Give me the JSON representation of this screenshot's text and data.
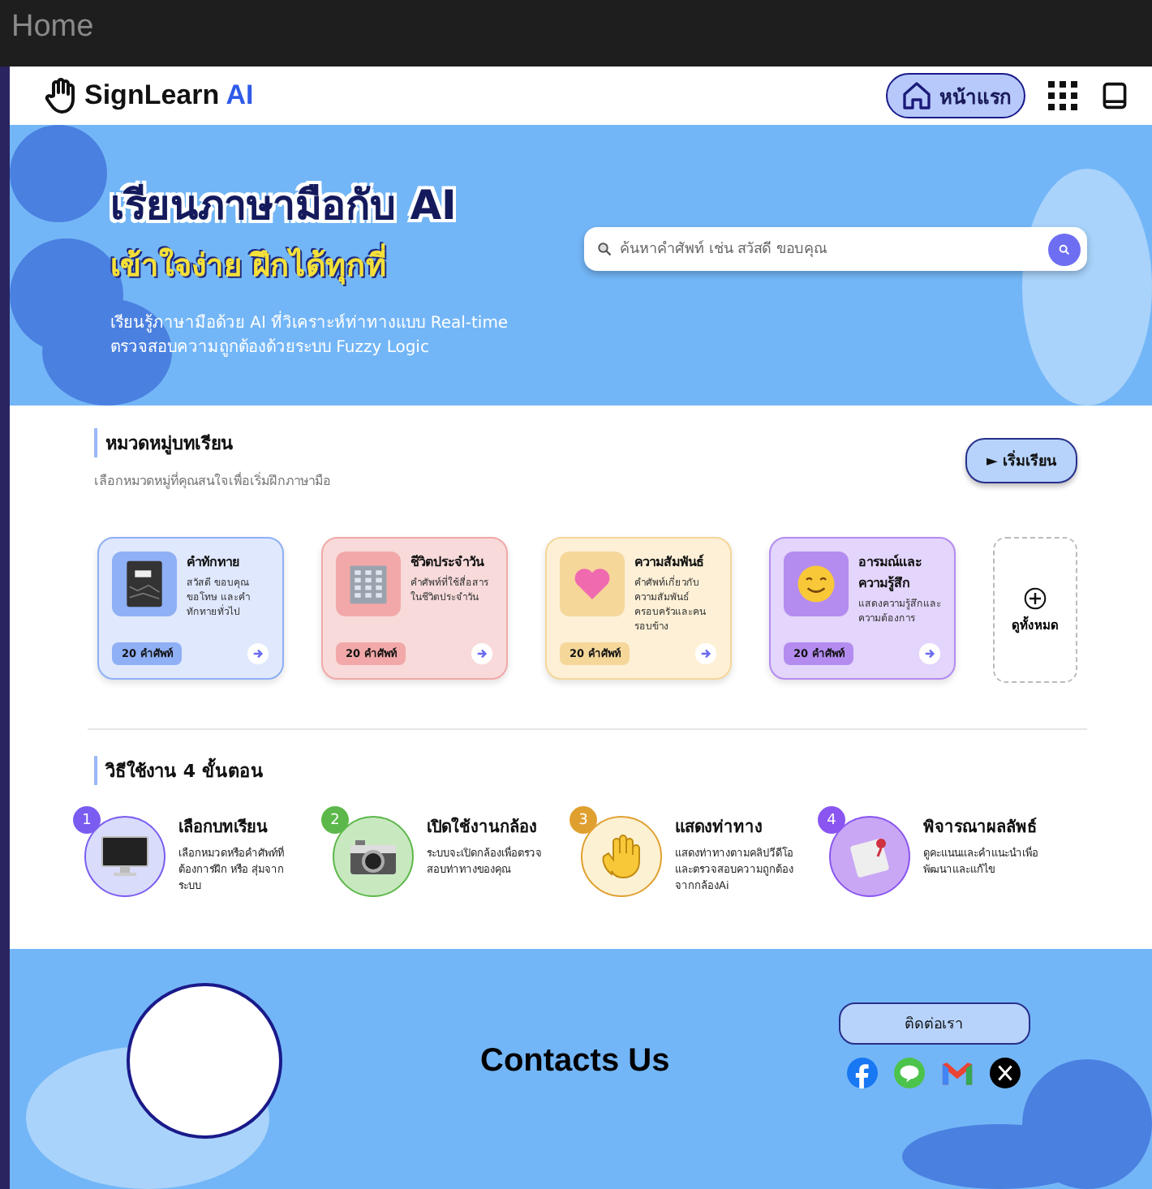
{
  "window": {
    "title": "Home"
  },
  "nav": {
    "logo": "SignLearn",
    "logo_accent": "AI",
    "home_button": "หน้าแรก"
  },
  "hero": {
    "title": "เรียนภาษามือกับ AI",
    "subtitle": "เข้าใจง่าย ฝึกได้ทุกที่",
    "description": [
      "เรียนรู้ภาษามือด้วย AI ที่วิเคราะห์ท่าทางแบบ Real-time",
      "ตรวจสอบความถูกต้องด้วยระบบ Fuzzy Logic"
    ],
    "search": {
      "placeholder": "ค้นหาคำศัพท์ เช่น สวัสดี ขอบคุณ"
    }
  },
  "categories": {
    "title": "หมวดหมู่บทเรียน",
    "subtitle": "เลือกหมวดหมู่ที่คุณสนใจเพื่อเริ่มฝึกภาษามือ",
    "start_button": "► เริ่มเรียน",
    "view_all": "ดูทั้งหมด",
    "items": [
      {
        "kind": "notebook",
        "title": "คำทักทาย",
        "description": "สวัสดี ขอบคุณ ขอโทษ และคำทักทายทั่วไป",
        "count": "20 คำศัพท์",
        "color": "#8fb0f5"
      },
      {
        "kind": "building",
        "title": "ชีวิตประจำวัน",
        "description": "คำศัพท์ที่ใช้สื่อสารในชีวิตประจำวัน",
        "count": "20 คำศัพท์",
        "color": "#f2a8a8"
      },
      {
        "kind": "heart",
        "title": "ความสัมพันธ์",
        "description": "คำศัพท์เกี่ยวกับความสัมพันธ์ครอบครัวและคนรอบข้าง",
        "count": "20 คำศัพท์",
        "color": "#f5d79a"
      },
      {
        "kind": "smile",
        "title": "อารมณ์และความรู้สึก",
        "description": "แสดงความรู้สึกและความต้องการ",
        "count": "20 คำศัพท์",
        "color": "#b48cf0"
      }
    ]
  },
  "steps": {
    "title": "วิธีใช้งาน 4 ขั้นตอน",
    "items": [
      {
        "kind": "monitor",
        "number": "1",
        "title": "เลือกบทเรียน",
        "description": "เลือกหมวดหรือคำศัพท์ที่ต้องการฝึก หรือ สุ่มจากระบบ",
        "color": "#7b5cf0"
      },
      {
        "kind": "camera",
        "number": "2",
        "title": "เปิดใช้งานกล้อง",
        "description": "ระบบจะเปิดกล้องเพื่อตรวจสอบท่าทางของคุณ",
        "color": "#5cb84a"
      },
      {
        "kind": "hand",
        "number": "3",
        "title": "แสดงท่าทาง",
        "description": "แสดงท่าทางตามคลิปวีดีโอและตรวจสอบความถูกต้องจากกล้องAi",
        "color": "#e0a030"
      },
      {
        "kind": "paper",
        "number": "4",
        "title": "พิจารณาผลลัพธ์",
        "description": "ดูคะแนนและคำแนะนำเพื่อพัฒนาและแก้ไข",
        "color": "#8a55f0"
      }
    ]
  },
  "footer": {
    "title": "Contacts Us",
    "contact_button": "ติดต่อเรา"
  }
}
